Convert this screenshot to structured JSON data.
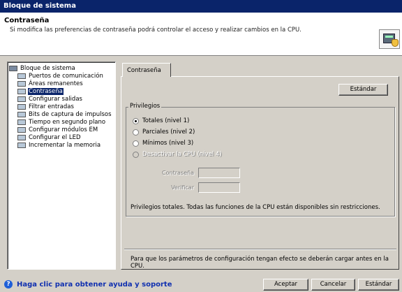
{
  "window": {
    "title": "Bloque de sistema"
  },
  "header": {
    "title": "Contraseña",
    "description": "Si modifica las preferencias de contraseña podrá controlar el acceso y realizar cambios en la CPU.",
    "icon": "cpu-hand-icon"
  },
  "tree": {
    "root": "Bloque de sistema",
    "items": [
      {
        "label": "Puertos de comunicación"
      },
      {
        "label": "Áreas remanentes"
      },
      {
        "label": "Contraseña",
        "selected": true
      },
      {
        "label": "Configurar salidas"
      },
      {
        "label": "Filtrar entradas"
      },
      {
        "label": "Bits de captura de impulsos"
      },
      {
        "label": "Tiempo en segundo plano"
      },
      {
        "label": "Configurar módulos EM"
      },
      {
        "label": "Configurar el LED"
      },
      {
        "label": "Incrementar la memoria"
      }
    ]
  },
  "tab": {
    "label": "Contraseña"
  },
  "buttons": {
    "estandar_top": "Estándar",
    "aceptar": "Aceptar",
    "cancelar": "Cancelar",
    "estandar_bottom": "Estándar"
  },
  "privileges": {
    "legend": "Privilegios",
    "options": [
      {
        "label": "Totales (nivel 1)",
        "checked": true,
        "enabled": true
      },
      {
        "label": "Parciales (nivel 2)",
        "checked": false,
        "enabled": true
      },
      {
        "label": "Mínimos (nivel 3)",
        "checked": false,
        "enabled": true
      },
      {
        "label": "Desactivar la CPU (nivel 4)",
        "checked": false,
        "enabled": false
      }
    ],
    "password_label": "Contraseña",
    "verify_label": "Verificar",
    "description": "Privilegios totales. Todas las funciones de la CPU están disponibles sin restricciones."
  },
  "bottom_note": "Para que los parámetros de configuración tengan efecto se deberán cargar antes en la CPU.",
  "help": {
    "icon": "help-icon",
    "text": "Haga clic para obtener ayuda y soporte"
  }
}
